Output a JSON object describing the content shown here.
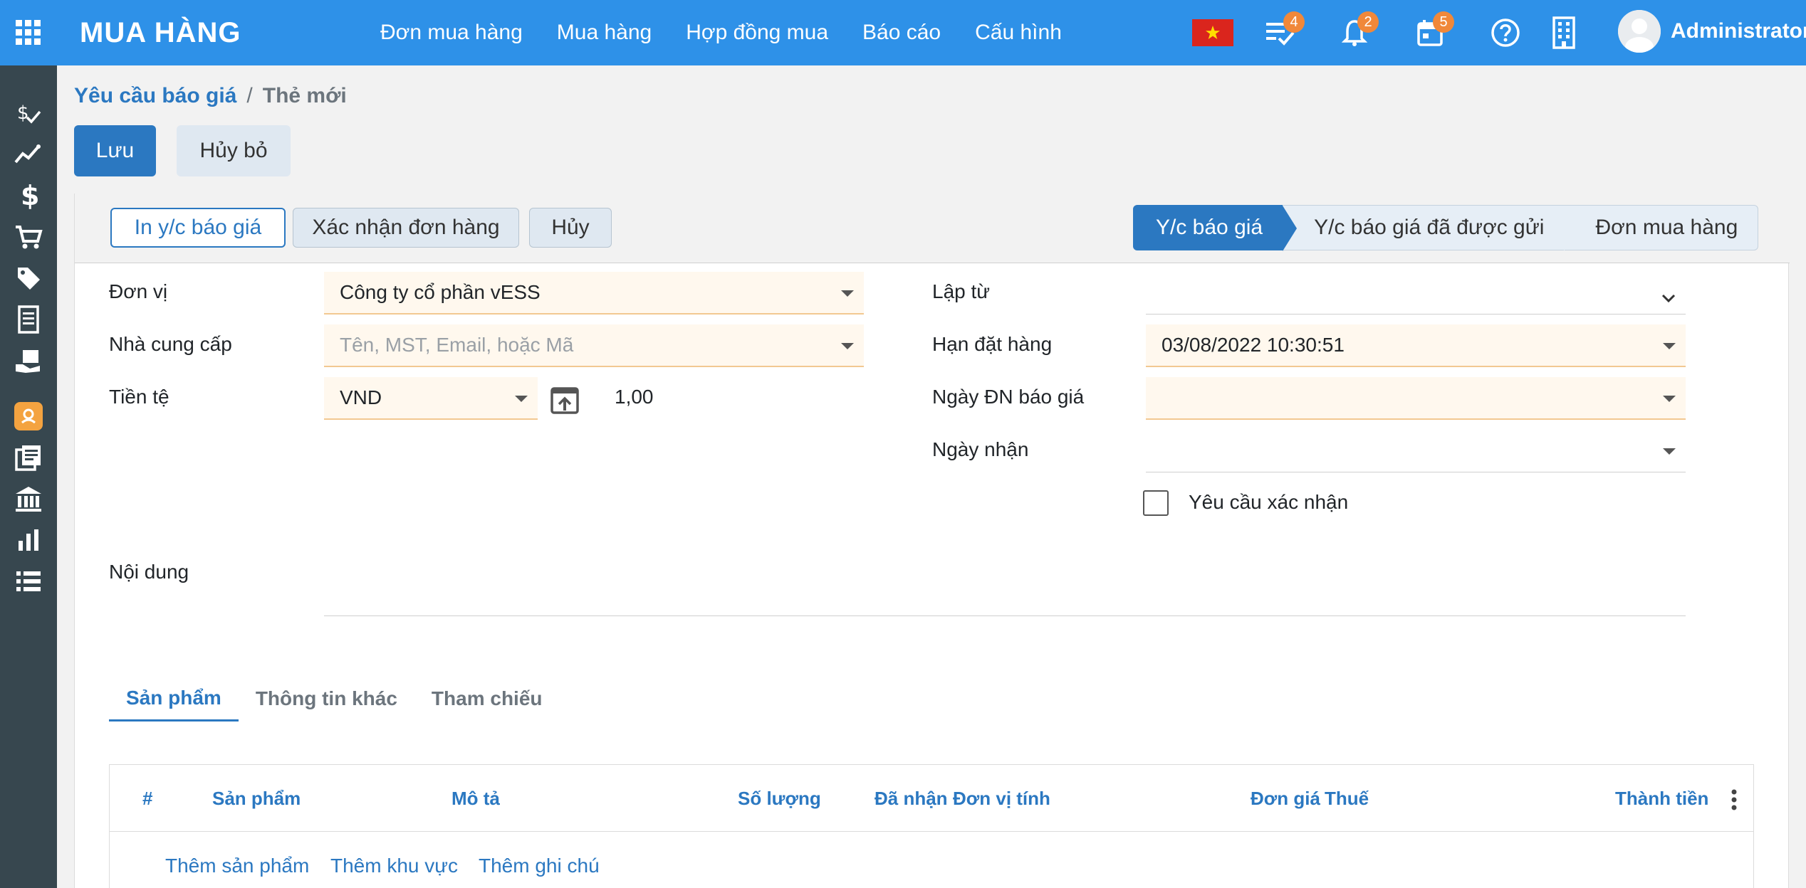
{
  "app": {
    "title": "MUA HÀNG"
  },
  "top_menu": [
    "Đơn mua hàng",
    "Mua hàng",
    "Hợp đồng mua",
    "Báo cáo",
    "Cấu hình"
  ],
  "top_icons": {
    "activities_badge": "4",
    "notifications_badge": "2",
    "calendar_badge": "5"
  },
  "user": {
    "name": "Administrator"
  },
  "breadcrumb": {
    "parent": "Yêu cầu báo giá",
    "separator": "/",
    "current": "Thẻ mới"
  },
  "actions": {
    "save": "Lưu",
    "discard": "Hủy bỏ"
  },
  "status_buttons": {
    "print": "In y/c báo giá",
    "confirm": "Xác nhận đơn hàng",
    "cancel": "Hủy"
  },
  "stages": [
    "Y/c báo giá",
    "Y/c báo giá đã được gửi",
    "Đơn mua hàng"
  ],
  "form": {
    "company_label": "Đơn vị",
    "company_value": "Công ty cổ phần vESS",
    "vendor_label": "Nhà cung cấp",
    "vendor_placeholder": "Tên, MST, Email, hoặc Mã",
    "currency_label": "Tiền tệ",
    "currency_value": "VND",
    "rate_value": "1,00",
    "origin_label": "Lập từ",
    "order_deadline_label": "Hạn đặt hàng",
    "order_deadline_value": "03/08/2022 10:30:51",
    "quote_date_label": "Ngày ĐN báo giá",
    "receipt_date_label": "Ngày nhận",
    "require_confirm_label": "Yêu cầu xác nhận",
    "content_label": "Nội dung"
  },
  "tabs": [
    "Sản phẩm",
    "Thông tin khác",
    "Tham chiếu"
  ],
  "table": {
    "headers": [
      "#",
      "Sản phẩm",
      "Mô tả",
      "Số lượng",
      "Đã nhận",
      "Đơn vị tính",
      "Đơn giá",
      "Thuế",
      "Thành tiền"
    ],
    "add_links": [
      "Thêm sản phẩm",
      "Thêm khu vực",
      "Thêm ghi chú"
    ]
  },
  "colors": {
    "topbar": "#2e91e8",
    "primary": "#2b78c1",
    "sidebar": "#37474f",
    "badge": "#f0883a"
  }
}
